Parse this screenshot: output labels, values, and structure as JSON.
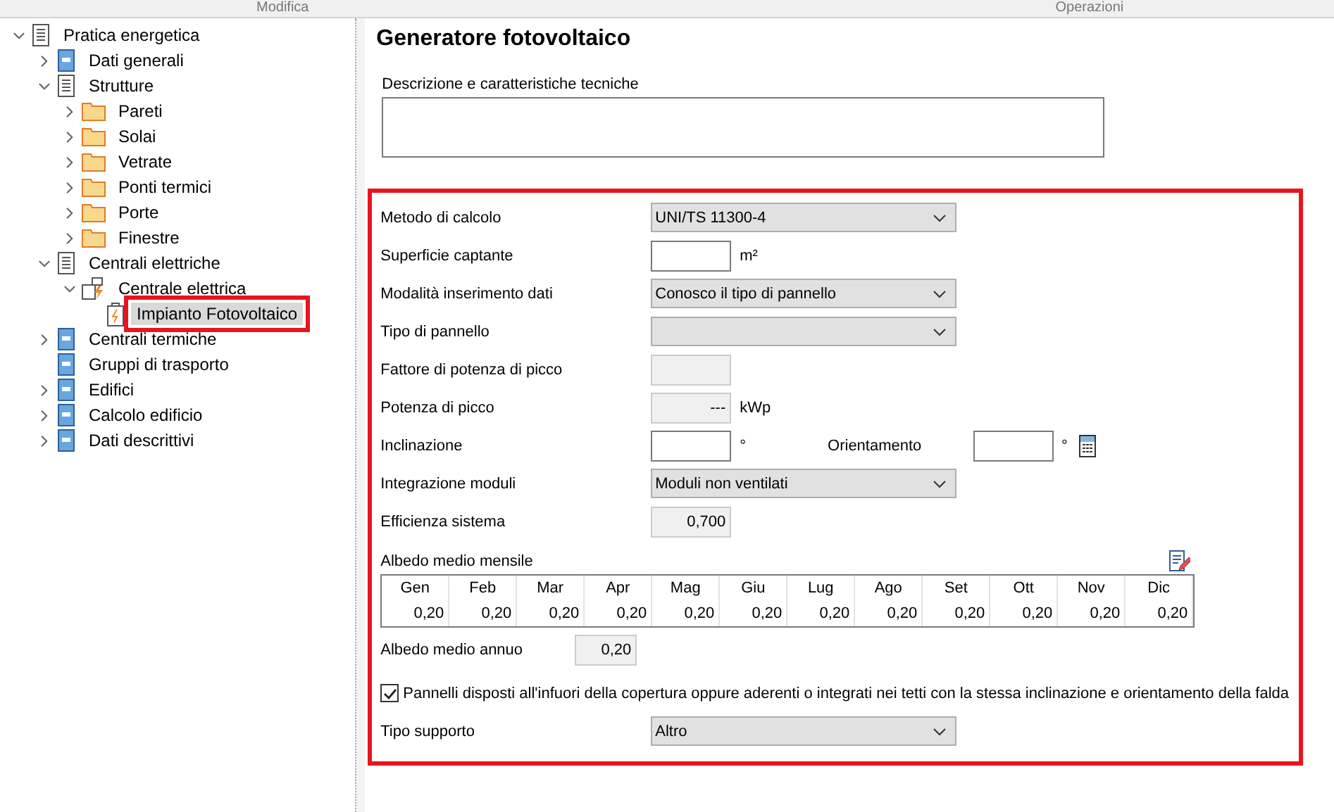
{
  "header": {
    "tabs": [
      "Modifica",
      "Operazioni"
    ]
  },
  "tree": [
    {
      "label": "Pratica energetica",
      "kind": "list",
      "expanded": true,
      "selected": false,
      "highlighted": false,
      "children": [
        {
          "label": "Dati generali",
          "kind": "form",
          "expanded": false,
          "selected": false,
          "highlighted": false
        },
        {
          "label": "Strutture",
          "kind": "list",
          "expanded": true,
          "selected": false,
          "highlighted": false,
          "children": [
            {
              "label": "Pareti",
              "kind": "folder",
              "expanded": false,
              "selected": false,
              "highlighted": false
            },
            {
              "label": "Solai",
              "kind": "folder",
              "expanded": false,
              "selected": false,
              "highlighted": false
            },
            {
              "label": "Vetrate",
              "kind": "folder",
              "expanded": false,
              "selected": false,
              "highlighted": false
            },
            {
              "label": "Ponti termici",
              "kind": "folder",
              "expanded": false,
              "selected": false,
              "highlighted": false
            },
            {
              "label": "Porte",
              "kind": "folder",
              "expanded": false,
              "selected": false,
              "highlighted": false
            },
            {
              "label": "Finestre",
              "kind": "folder",
              "expanded": false,
              "selected": false,
              "highlighted": false
            }
          ]
        },
        {
          "label": "Centrali elettriche",
          "kind": "list",
          "expanded": true,
          "selected": false,
          "highlighted": false,
          "children": [
            {
              "label": "Centrale elettrica",
              "kind": "plant",
              "expanded": true,
              "selected": false,
              "highlighted": false,
              "children": [
                {
                  "label": "Impianto Fotovoltaico",
                  "kind": "battery",
                  "selected": true,
                  "highlighted": true
                }
              ]
            }
          ]
        },
        {
          "label": "Centrali termiche",
          "kind": "form",
          "expanded": false,
          "selected": false,
          "highlighted": false
        },
        {
          "label": "Gruppi di trasporto",
          "kind": "form",
          "selected": false,
          "highlighted": false
        },
        {
          "label": "Edifici",
          "kind": "form",
          "expanded": false,
          "selected": false,
          "highlighted": false
        },
        {
          "label": "Calcolo edificio",
          "kind": "form",
          "expanded": false,
          "selected": false,
          "highlighted": false
        },
        {
          "label": "Dati descrittivi",
          "kind": "form",
          "expanded": false,
          "selected": false,
          "highlighted": false
        }
      ]
    }
  ],
  "title": "Generatore fotovoltaico",
  "description": {
    "label": "Descrizione e caratteristiche tecniche"
  },
  "section": {
    "highlighted": true,
    "rows": [
      {
        "kind": "select",
        "label": "Metodo di calcolo",
        "value": "UNI/TS 11300-4"
      },
      {
        "kind": "input",
        "label": "Superficie captante",
        "unit": "m²"
      },
      {
        "kind": "select",
        "label": "Modalità inserimento dati",
        "value": "Conosco il tipo di pannello"
      },
      {
        "kind": "select",
        "label": "Tipo di pannello"
      },
      {
        "kind": "readonly",
        "label": "Fattore di potenza di picco"
      },
      {
        "kind": "readonly",
        "label": "Potenza di picco",
        "value": "---",
        "unit": "kWp"
      },
      {
        "kind": "pair",
        "label": "Inclinazione",
        "unit": "°",
        "label2": "Orientamento",
        "unit2": "°"
      },
      {
        "kind": "select",
        "label": "Integrazione moduli",
        "value": "Moduli non ventilati"
      },
      {
        "kind": "readonly",
        "label": "Efficienza sistema",
        "value": "0,700"
      }
    ],
    "albedo": {
      "label": "Albedo medio mensile",
      "months": [
        {
          "month": "Gen",
          "value": "0,20"
        },
        {
          "month": "Feb",
          "value": "0,20"
        },
        {
          "month": "Mar",
          "value": "0,20"
        },
        {
          "month": "Apr",
          "value": "0,20"
        },
        {
          "month": "Mag",
          "value": "0,20"
        },
        {
          "month": "Giu",
          "value": "0,20"
        },
        {
          "month": "Lug",
          "value": "0,20"
        },
        {
          "month": "Ago",
          "value": "0,20"
        },
        {
          "month": "Set",
          "value": "0,20"
        },
        {
          "month": "Ott",
          "value": "0,20"
        },
        {
          "month": "Nov",
          "value": "0,20"
        },
        {
          "month": "Dic",
          "value": "0,20"
        }
      ],
      "annual_label": "Albedo medio annuo",
      "annual_value": "0,20"
    },
    "checkbox": {
      "checked": true,
      "label": "Pannelli disposti all'infuori della copertura oppure aderenti o integrati nei tetti con la stessa inclinazione e orientamento della falda"
    },
    "support": {
      "label": "Tipo supporto",
      "value": "Altro"
    }
  }
}
